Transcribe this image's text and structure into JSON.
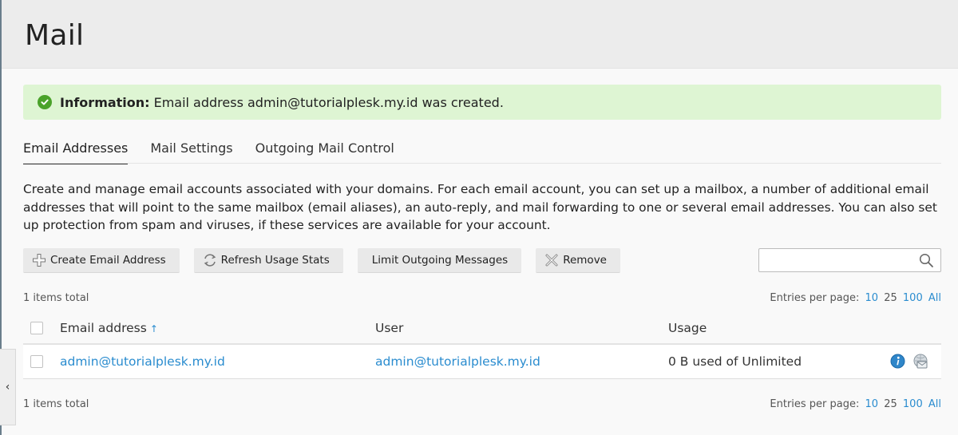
{
  "page": {
    "title": "Mail"
  },
  "info": {
    "label": "Information:",
    "message": "Email address admin@tutorialplesk.my.id was created."
  },
  "tabs": [
    {
      "label": "Email Addresses",
      "active": true
    },
    {
      "label": "Mail Settings",
      "active": false
    },
    {
      "label": "Outgoing Mail Control",
      "active": false
    }
  ],
  "description": "Create and manage email accounts associated with your domains. For each email account, you can set up a mailbox, a number of additional email addresses that will point to the same mailbox (email aliases), an auto-reply, and mail forwarding to one or several email addresses. You can also set up protection from spam and viruses, if these services are available for your account.",
  "toolbar": {
    "create_label": "Create Email Address",
    "refresh_label": "Refresh Usage Stats",
    "limit_label": "Limit Outgoing Messages",
    "remove_label": "Remove"
  },
  "search": {
    "placeholder": "",
    "value": ""
  },
  "pagination": {
    "total_text": "1 items total",
    "per_page_label": "Entries per page:",
    "options": [
      "10",
      "25",
      "100",
      "All"
    ],
    "current": "25"
  },
  "table": {
    "headers": {
      "email": "Email address",
      "sort_arrow": "↑",
      "user": "User",
      "usage": "Usage"
    },
    "rows": [
      {
        "email": "admin@tutorialplesk.my.id",
        "user": "admin@tutorialplesk.my.id",
        "usage": "0 B used of Unlimited"
      }
    ]
  },
  "icons": [
    "check-circle-icon",
    "plus-icon",
    "refresh-icon",
    "remove-x-icon",
    "search-icon",
    "info-icon",
    "webmail-icon",
    "chevron-left-icon"
  ],
  "colors": {
    "accent": "#2a8ccf",
    "success_bg": "#def5d3",
    "success_icon": "#4aa22a"
  },
  "sidebar_toggle": {
    "glyph": "‹"
  }
}
